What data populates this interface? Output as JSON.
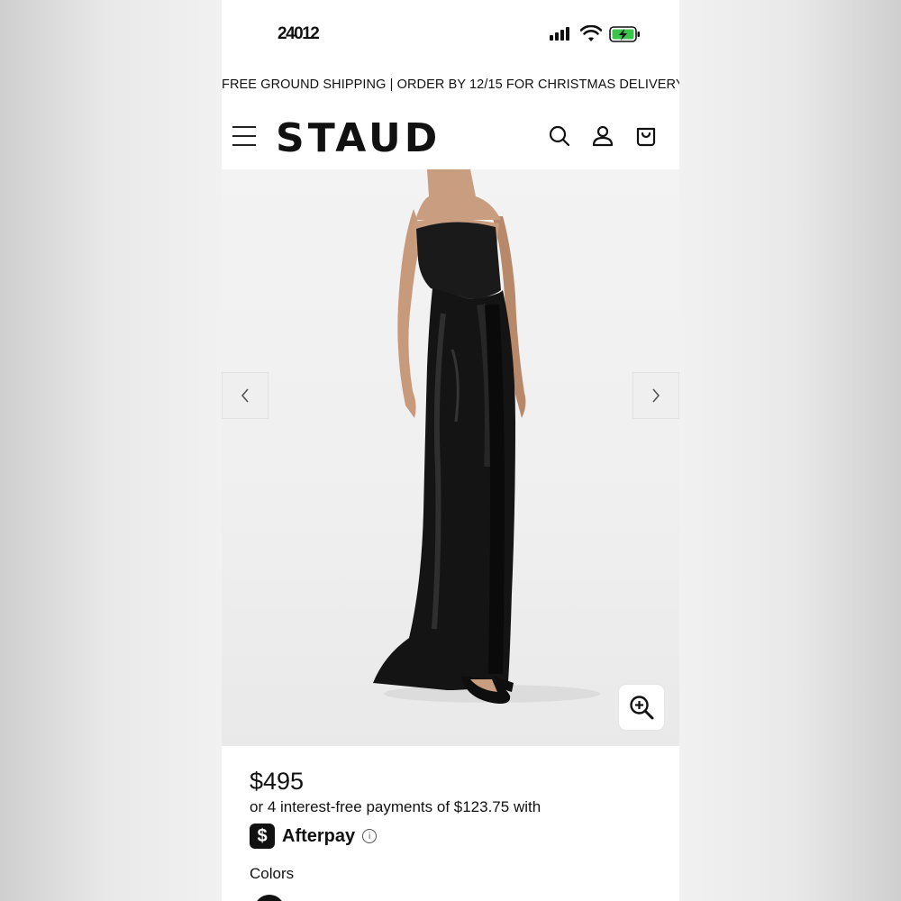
{
  "status_bar": {
    "time": "24012",
    "icons": [
      "signal-bars-icon",
      "wifi-icon",
      "battery-charging-icon"
    ],
    "battery_color": "#3bc44b"
  },
  "promo": {
    "text": "FREE GROUND SHIPPING | ORDER BY 12/15 FOR CHRISTMAS DELIVERY"
  },
  "header": {
    "logo": "STAUD",
    "icons": [
      "menu-icon",
      "search-icon",
      "account-icon",
      "cart-icon"
    ]
  },
  "gallery": {
    "prev_icon": "chevron-left-icon",
    "next_icon": "chevron-right-icon",
    "zoom_icon": "zoom-in-icon",
    "image_alt": "model wearing black strapless satin gown"
  },
  "product": {
    "price": "$495",
    "installments": "or 4 interest-free payments of $123.75 with",
    "afterpay_badge": "$",
    "afterpay_name": "Afterpay",
    "info_icon": "i",
    "colors_label": "Colors",
    "swatch_color": "#111111"
  },
  "colors": {
    "background": "#f1f1f1",
    "page": "#ffffff",
    "text": "#111111"
  }
}
